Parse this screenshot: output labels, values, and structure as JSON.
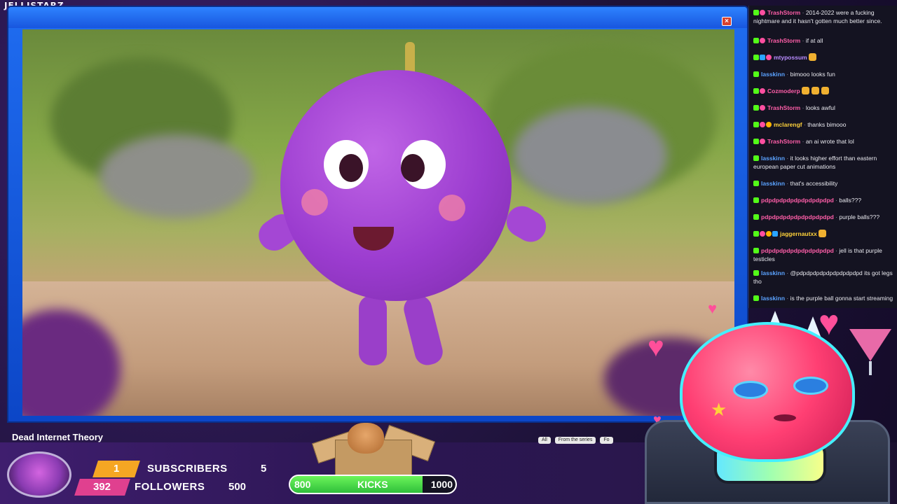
{
  "brand": {
    "name": "JELLISTARZ"
  },
  "video": {
    "caption": "Dead Internet Theory",
    "controls": [
      "All",
      "From the series",
      "Fo"
    ]
  },
  "chat": {
    "messages": [
      {
        "user": "TrashStorm",
        "user_color": "#ff5ea8",
        "text": "2014-2022 were a fucking nightmare and it hasn't gotten much better since.",
        "badges": [
          "k",
          "star"
        ]
      },
      {
        "user": "TrashStorm",
        "user_color": "#ff5ea8",
        "text": "if at all",
        "badges": [
          "k",
          "star"
        ]
      },
      {
        "user": "mtypossum",
        "user_color": "#b98cff",
        "text": "",
        "badges": [
          "k",
          "blue",
          "star"
        ],
        "emotes": 1
      },
      {
        "user": "lasskinn",
        "user_color": "#5aa2ff",
        "text": "bimooo looks fun",
        "badges": [
          "k"
        ]
      },
      {
        "user": "Cozmoderp",
        "user_color": "#ff5ea8",
        "text": "",
        "badges": [
          "k",
          "star"
        ],
        "emotes": 3
      },
      {
        "user": "TrashStorm",
        "user_color": "#ff5ea8",
        "text": "looks awful",
        "badges": [
          "k",
          "star"
        ]
      },
      {
        "user": "mclarengf",
        "user_color": "#ffd23a",
        "text": "thanks bimooo",
        "badges": [
          "k",
          "star",
          "gold"
        ]
      },
      {
        "user": "TrashStorm",
        "user_color": "#ff5ea8",
        "text": "an ai wrote that lol",
        "badges": [
          "k",
          "star"
        ]
      },
      {
        "user": "lasskinn",
        "user_color": "#5aa2ff",
        "text": "it looks higher effort than eastern european paper cut animations",
        "badges": [
          "k"
        ]
      },
      {
        "user": "lasskinn",
        "user_color": "#5aa2ff",
        "text": "that's accessibility",
        "badges": [
          "k"
        ]
      },
      {
        "user": "pdpdpdpdpdpdpdpdpdpd",
        "user_color": "#ff5ea8",
        "text": "balls???",
        "badges": [
          "k"
        ]
      },
      {
        "user": "pdpdpdpdpdpdpdpdpdpd",
        "user_color": "#ff5ea8",
        "text": "purple balls???",
        "badges": [
          "k"
        ]
      },
      {
        "user": "jaggernautxx",
        "user_color": "#ffd23a",
        "text": "",
        "badges": [
          "k",
          "star",
          "gold",
          "blue"
        ],
        "emotes": 1
      },
      {
        "user": "pdpdpdpdpdpdpdpdpdpd",
        "user_color": "#ff5ea8",
        "text": "jell is that purple testicles",
        "badges": [
          "k"
        ]
      },
      {
        "user": "lasskinn",
        "user_color": "#5aa2ff",
        "text": "@pdpdpdpdpdpdpdpdpdpd its got legs tho",
        "badges": [
          "k"
        ]
      },
      {
        "user": "lasskinn",
        "user_color": "#5aa2ff",
        "text": "is the purple ball gonna start streaming",
        "badges": [
          "k"
        ]
      }
    ]
  },
  "stats": {
    "subscribers": {
      "current": "1",
      "label": "SUBSCRIBERS",
      "goal": "5"
    },
    "followers": {
      "current": "392",
      "label": "FOLLOWERS",
      "goal": "500"
    },
    "kicks": {
      "current": "800",
      "label": "KICKS",
      "goal": "1000",
      "progress": 0.8
    }
  },
  "colors": {
    "subs": "#f5a623",
    "followers": "#e0408f",
    "kicks": "#35c93f",
    "window": "#1856de"
  }
}
